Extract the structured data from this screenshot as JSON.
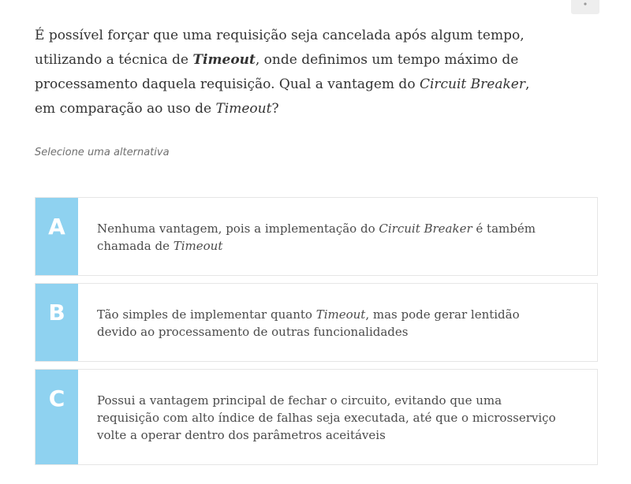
{
  "menu": {
    "icon": "more-vertical-icon"
  },
  "question": {
    "part1": "É possível forçar que uma requisição seja cancelada após algum tempo, utilizando a técnica de ",
    "term1": "Timeout",
    "part2": ", onde definimos um tempo máximo de processamento daquela requisição. Qual a vantagem do ",
    "term2": "Circuit Breaker",
    "part3": ", em comparação ao uso de ",
    "term3": "Timeout",
    "part4": "?"
  },
  "hint": "Selecione uma alternativa",
  "options": [
    {
      "letter": "A",
      "part1": "Nenhuma vantagem, pois a implementação do ",
      "term": "Circuit Breaker",
      "part2": " é também chamada de ",
      "term2": "Timeout"
    },
    {
      "letter": "B",
      "part1": "Tão simples de implementar quanto ",
      "term": "Timeout",
      "part2": ", mas pode gerar lentidão devido ao processamento de outras funcionalidades"
    },
    {
      "letter": "C",
      "text": "Possui a vantagem principal de fechar o circuito, evitando que uma requisição com alto índice de falhas seja executada, até que o microsserviço volte a operar dentro dos parâmetros aceitáveis"
    }
  ],
  "colors": {
    "letter_bg": "#8fd2f0",
    "border": "#e6e6e6"
  }
}
